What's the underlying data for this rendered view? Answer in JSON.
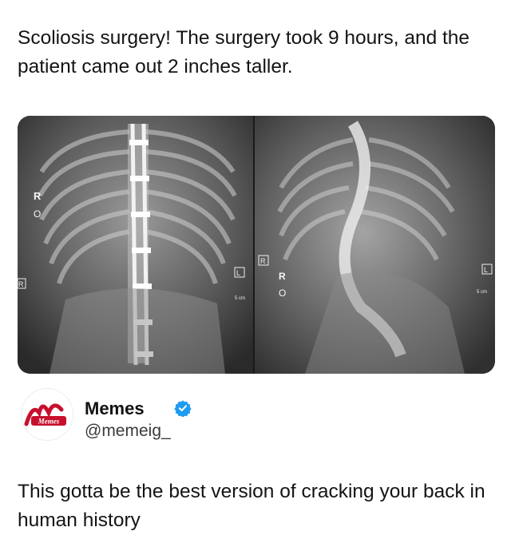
{
  "post": {
    "headline": "Scoliosis surgery! The surgery took 9 hours, and the patient came out 2 inches taller."
  },
  "image": {
    "left_markers": {
      "r": "R",
      "o": "O",
      "box_r": "R",
      "box_l": "L",
      "scale": "5 cm"
    },
    "right_markers": {
      "r": "R",
      "o": "O",
      "box_l": "L",
      "scale": "5 cm"
    }
  },
  "tweet": {
    "author_name": "Memes",
    "author_handle": "@memeig_",
    "avatar_text": "Memes",
    "verified_color": "#1d9bf0",
    "text": "This gotta be the best version of cracking your back in human history"
  },
  "colors": {
    "brand_red": "#c8102e"
  }
}
